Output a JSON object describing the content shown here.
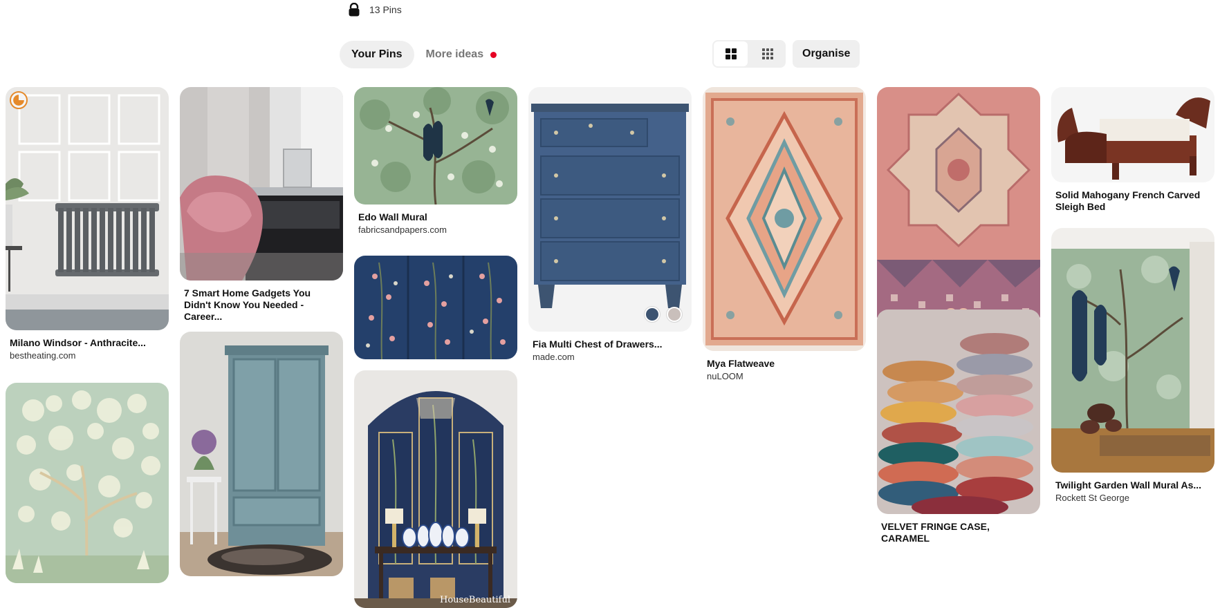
{
  "board": {
    "pin_count_label": "13 Pins",
    "lock_icon": "lock-icon"
  },
  "tabs": {
    "your_pins": "Your Pins",
    "more_ideas": "More ideas",
    "more_ideas_dot_color": "#e60023"
  },
  "toolbar": {
    "organise": "Organise",
    "default_view_icon": "grid-default-icon",
    "compact_view_icon": "grid-compact-icon"
  },
  "pins": [
    {
      "title": "Milano Windsor - Anthracite...",
      "source": "bestheating.com",
      "subject": "grey radiator against white panelled wall"
    },
    {
      "title": "",
      "source": "",
      "subject": "pale green chinoiserie floral wallpaper"
    },
    {
      "title": "7 Smart Home Gadgets You Didn't Know You Needed - Career...",
      "source": "",
      "subject": "pink velvet chair and mirrored desk"
    },
    {
      "title": "",
      "source": "",
      "subject": "blue-grey painted armoire"
    },
    {
      "title": "Edo Wall Mural",
      "source": "fabricsandpapers.com",
      "subject": "green mural with peacocks"
    },
    {
      "title": "",
      "source": "",
      "subject": "navy floral chinoiserie panels"
    },
    {
      "title": "",
      "source": "",
      "subject": "console table with chinoiserie panels",
      "watermark": "HouseBeautiful"
    },
    {
      "title": "Fia Multi Chest of Drawers...",
      "source": "made.com",
      "subject": "blue chest of drawers",
      "swatches": [
        "#3d5471",
        "#c9bfbb"
      ]
    },
    {
      "title": "Mya Flatweave",
      "source": "nuLOOM",
      "subject": "orange and blue medallion rug"
    },
    {
      "title": "",
      "source": "",
      "subject": "pink vintage Turkish rug"
    },
    {
      "title": "VELVET FRINGE CASE, CARAMEL",
      "source": "",
      "subject": "stacked velvet cushions"
    },
    {
      "title": "Solid Mahogany French Carved Sleigh Bed",
      "source": "",
      "subject": "mahogany sleigh bed"
    },
    {
      "title": "Twilight Garden Wall Mural As...",
      "source": "Rockett St George",
      "subject": "green peacock wall mural in room"
    }
  ]
}
